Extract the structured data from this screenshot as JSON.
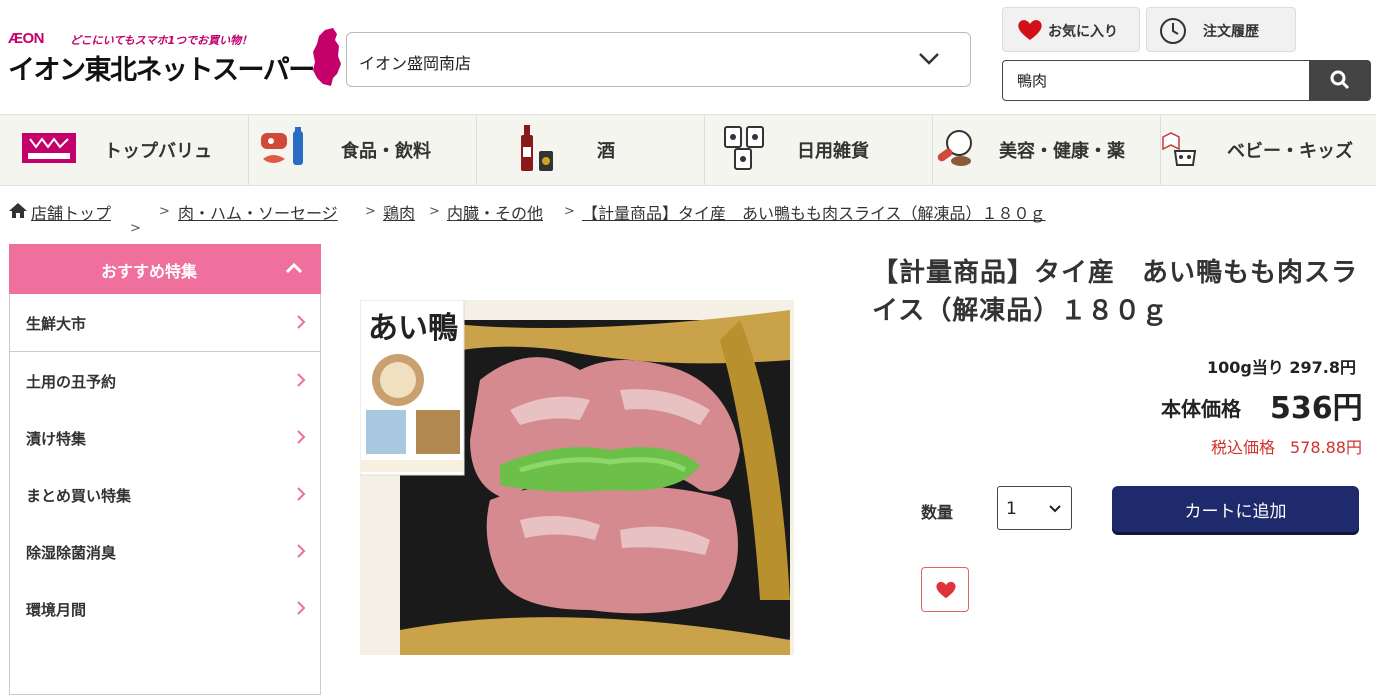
{
  "header": {
    "logo_brand": "ÆON",
    "logo_tagline": "どこにいてもスマホ1つでお買い物！",
    "logo_name": "イオン東北ネットスーパー",
    "store": "イオン盛岡南店",
    "favorites_label": "お気に入り",
    "history_label": "注文履歴",
    "search_value": "鴨肉"
  },
  "categories": [
    {
      "label": "トップバリュ",
      "icon": "topvalu-logo-icon"
    },
    {
      "label": "食品・飲料",
      "icon": "food-drink-icon"
    },
    {
      "label": "酒",
      "icon": "alcohol-icon"
    },
    {
      "label": "日用雑貨",
      "icon": "daily-goods-icon"
    },
    {
      "label": "美容・健康・薬",
      "icon": "beauty-health-icon"
    },
    {
      "label": "ベビー・キッズ",
      "icon": "baby-kids-icon"
    }
  ],
  "breadcrumb": {
    "home": "店舗トップ",
    "items": [
      "肉・ハム・ソーセージ",
      "鶏肉",
      "内臓・その他",
      "【計量商品】タイ産　あい鴨もも肉スライス（解凍品）１８０ｇ"
    ]
  },
  "sidebar": {
    "title": "おすすめ特集",
    "items": [
      "生鮮大市",
      "土用の丑予約",
      "漬け特集",
      "まとめ買い特集",
      "除湿除菌消臭",
      "環境月間"
    ]
  },
  "product": {
    "title": "【計量商品】タイ産　あい鴨もも肉スライス（解凍品）１８０ｇ",
    "unit_price": "100g当り 297.8円",
    "base_price_label": "本体価格",
    "base_price": "536円",
    "tax_price_label": "税込価格",
    "tax_price": "578.88円",
    "quantity_label": "数量",
    "quantity": "1",
    "cart_button": "カートに追加",
    "image_label": "あい鴨"
  },
  "colors": {
    "brand": "#c4006a",
    "sidebar_header": "#ef6f9d",
    "cart_button": "#1e2a6b",
    "tax_price": "#d0312d"
  }
}
